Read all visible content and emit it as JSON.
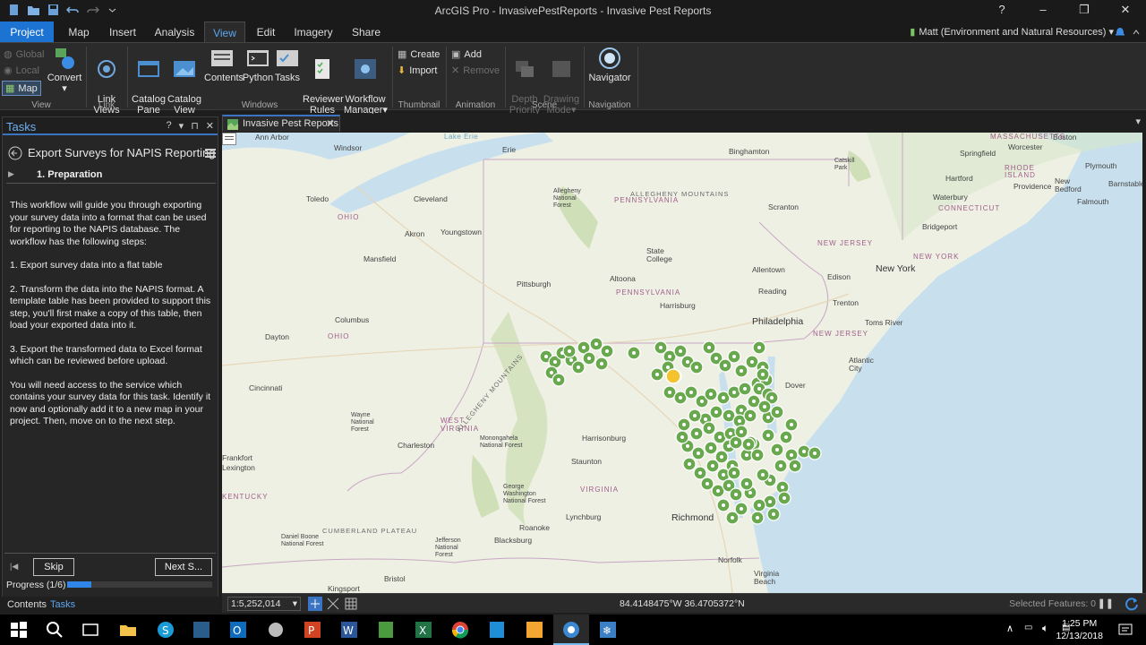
{
  "window": {
    "title": "ArcGIS Pro - InvasivePestReports - Invasive Pest Reports",
    "help": "?",
    "minimize": "–",
    "maximize": "❐",
    "close": "✕"
  },
  "ribbon_tabs": [
    {
      "label": "Project"
    },
    {
      "label": "Map"
    },
    {
      "label": "Insert"
    },
    {
      "label": "Analysis"
    },
    {
      "label": "View"
    },
    {
      "label": "Edit"
    },
    {
      "label": "Imagery"
    },
    {
      "label": "Share"
    }
  ],
  "user": {
    "name": "Matt (Environment and Natural Resources)"
  },
  "ribbon": {
    "view_group": {
      "label": "View",
      "global": "Global",
      "local": "Local",
      "map": "Map",
      "convert": "Convert"
    },
    "link_group": {
      "label": "Link",
      "link_views": "Link\nViews"
    },
    "windows_group": {
      "label": "Windows",
      "catalog_pane": "Catalog\nPane",
      "catalog_view": "Catalog\nView",
      "contents": "Contents",
      "python": "Python",
      "tasks": "Tasks",
      "reviewer_rules": "Reviewer\nRules",
      "workflow_manager": "Workflow\nManager"
    },
    "thumbnail_group": {
      "label": "Thumbnail",
      "create": "Create",
      "import": "Import"
    },
    "animation_group": {
      "label": "Animation",
      "add": "Add",
      "remove": "Remove"
    },
    "scene_group": {
      "label": "Scene",
      "depth_priority": "Depth\nPriority",
      "drawing_mode": "Drawing\nMode"
    },
    "navigation_group": {
      "label": "Navigation",
      "navigator": "Navigator"
    }
  },
  "tasks_pane": {
    "title": "Tasks",
    "task_name": "Export Surveys for NAPIS Reporting",
    "step": "1.  Preparation",
    "paragraphs": [
      "This workflow will guide you through exporting your survey data into a format that can be used for reporting to the NAPIS database. The workflow has the following steps:",
      "1. Export survey data into a flat table",
      "2. Transform the data into the NAPIS format. A template table has been provided to support this step, you'll first make a copy of this table, then load your exported data into it.",
      "3. Export the transformed data to Excel format which can be reviewed before upload.",
      "You will need access to the service which contains your survey data for this task. Identify it now and optionally add it to a new map in your project. Then, move on to the next step."
    ],
    "skip": "Skip",
    "next": "Next S...",
    "progress_label": "Progress (1/6)",
    "progress_fraction": 0.1667
  },
  "pane_tabs": {
    "contents": "Contents",
    "tasks": "Tasks"
  },
  "map_tab": {
    "label": "Invasive Pest Reports"
  },
  "map_labels": {
    "cities": [
      "Ann Arbor",
      "Windsor",
      "Erie",
      "Binghamton",
      "Toledo",
      "Cleveland",
      "Youngstown",
      "Akron",
      "Mansfield",
      "Pittsburgh",
      "State College",
      "Altoona",
      "Harrisburg",
      "Scranton",
      "Allentown",
      "Reading",
      "Philadelphia",
      "Trenton",
      "New York",
      "Edison",
      "Bridgeport",
      "Hartford",
      "Springfield",
      "Worcester",
      "Boston",
      "Providence",
      "Waterbury",
      "New Bedford",
      "Plymouth",
      "Barnstable",
      "Falmouth",
      "Columbus",
      "Dayton",
      "Cincinnati",
      "Charleston",
      "Harrisonburg",
      "Staunton",
      "Lynchburg",
      "Roanoke",
      "Blacksburg",
      "Richmond",
      "Norfolk",
      "Virginia Beach",
      "Dover",
      "Atlantic City",
      "Toms River",
      "Bristol",
      "Kingsport",
      "Lexington",
      "Frankfort",
      "Wayne National Forest",
      "Monongahela National Forest",
      "George Washington National Forest",
      "Jefferson National Forest",
      "Daniel Boone National Forest",
      "Allegheny National Forest"
    ],
    "states": [
      "PENNSYLVANIA",
      "OHIO",
      "NEW JERSEY",
      "NEW YORK",
      "CONNECTICUT",
      "RHODE ISLAND",
      "MASSACHUSETTS",
      "WEST VIRGINIA",
      "VIRGINIA",
      "KENTUCKY"
    ],
    "features": [
      "Lake Erie",
      "ALLEGHENY MOUNTAINS",
      "ALLEGHENY MOUNTAINS",
      "CUMBERLAND PLATEAU",
      "Catskill Park"
    ]
  },
  "status": {
    "scale": "1:5,252,014",
    "coordinates": "84.4148475°W 36.4705372°N",
    "selected": "Selected Features: 0"
  },
  "taskbar": {
    "time": "1:25 PM",
    "date": "12/13/2018"
  },
  "colors": {
    "accent": "#1c73d2",
    "tab_active": "#59a6f0",
    "points": "#6aa84f",
    "selected_point": "#f4c430",
    "water": "#c8e0ee",
    "land": "#eef0e4"
  }
}
